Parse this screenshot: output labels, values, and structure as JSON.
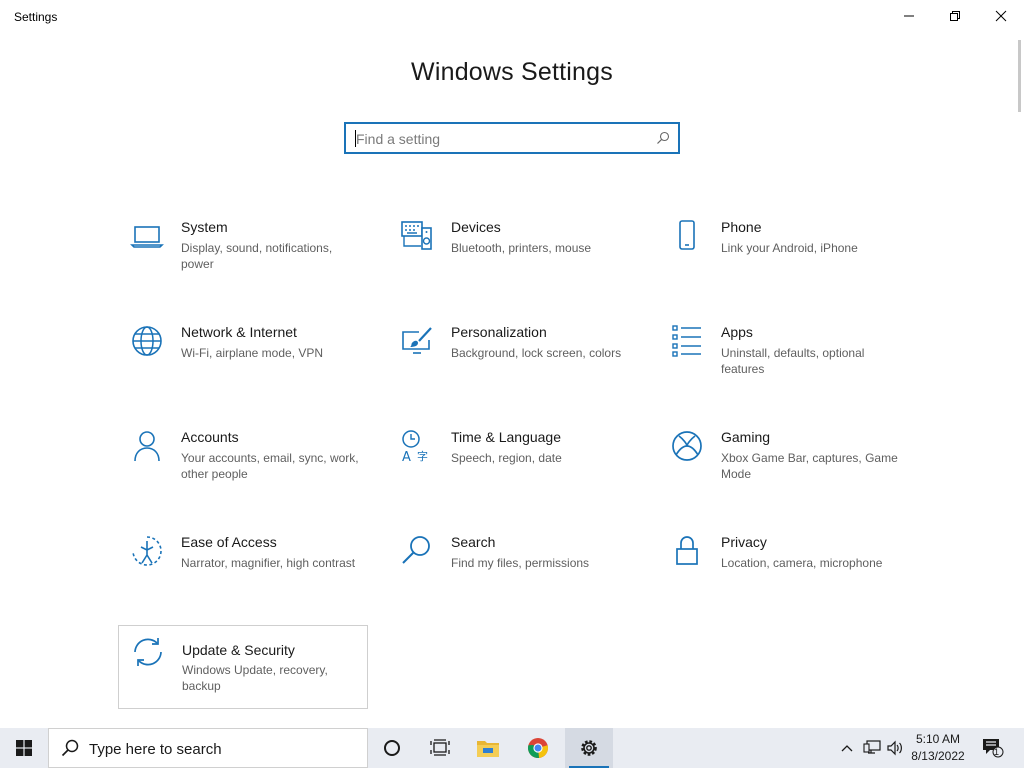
{
  "window": {
    "title": "Settings",
    "minimize_icon": "minimize-icon",
    "maximize_icon": "restore-icon",
    "close_icon": "close-icon"
  },
  "header": {
    "title": "Windows Settings"
  },
  "search": {
    "placeholder": "Find a setting",
    "value": "",
    "icon": "search-icon"
  },
  "categories": [
    {
      "name": "System",
      "description": "Display, sound, notifications, power",
      "icon": "laptop-icon"
    },
    {
      "name": "Devices",
      "description": "Bluetooth, printers, mouse",
      "icon": "keyboard-speaker-icon"
    },
    {
      "name": "Phone",
      "description": "Link your Android, iPhone",
      "icon": "phone-icon"
    },
    {
      "name": "Network & Internet",
      "description": "Wi-Fi, airplane mode, VPN",
      "icon": "globe-icon"
    },
    {
      "name": "Personalization",
      "description": "Background, lock screen, colors",
      "icon": "paintbrush-icon"
    },
    {
      "name": "Apps",
      "description": "Uninstall, defaults, optional features",
      "icon": "apps-list-icon"
    },
    {
      "name": "Accounts",
      "description": "Your accounts, email, sync, work, other people",
      "icon": "person-icon"
    },
    {
      "name": "Time & Language",
      "description": "Speech, region, date",
      "icon": "time-language-icon"
    },
    {
      "name": "Gaming",
      "description": "Xbox Game Bar, captures, Game Mode",
      "icon": "xbox-icon"
    },
    {
      "name": "Ease of Access",
      "description": "Narrator, magnifier, high contrast",
      "icon": "ease-of-access-icon"
    },
    {
      "name": "Search",
      "description": "Find my files, permissions",
      "icon": "magnifier-icon"
    },
    {
      "name": "Privacy",
      "description": "Location, camera, microphone",
      "icon": "lock-icon"
    },
    {
      "name": "Update & Security",
      "description": "Windows Update, recovery, backup",
      "icon": "sync-icon",
      "selected": true
    }
  ],
  "taskbar": {
    "start_icon": "windows-logo-icon",
    "search_label": "Type here to search",
    "search_icon": "search-icon",
    "pinned": [
      {
        "name": "cortana-icon"
      },
      {
        "name": "task-view-icon"
      },
      {
        "name": "file-explorer-icon"
      },
      {
        "name": "chrome-icon"
      },
      {
        "name": "settings-gear-icon",
        "active": true
      }
    ],
    "tray": {
      "chevron_icon": "chevron-up-icon",
      "network_icon": "network-icon",
      "volume_icon": "volume-icon",
      "time": "5:10 AM",
      "date": "8/13/2022",
      "notifications_icon": "action-center-icon",
      "notifications_count": "1"
    }
  },
  "colors": {
    "accent": "#0063b1",
    "icon_blue": "#1a73b8",
    "taskbar_bg": "#e9ecf2"
  }
}
